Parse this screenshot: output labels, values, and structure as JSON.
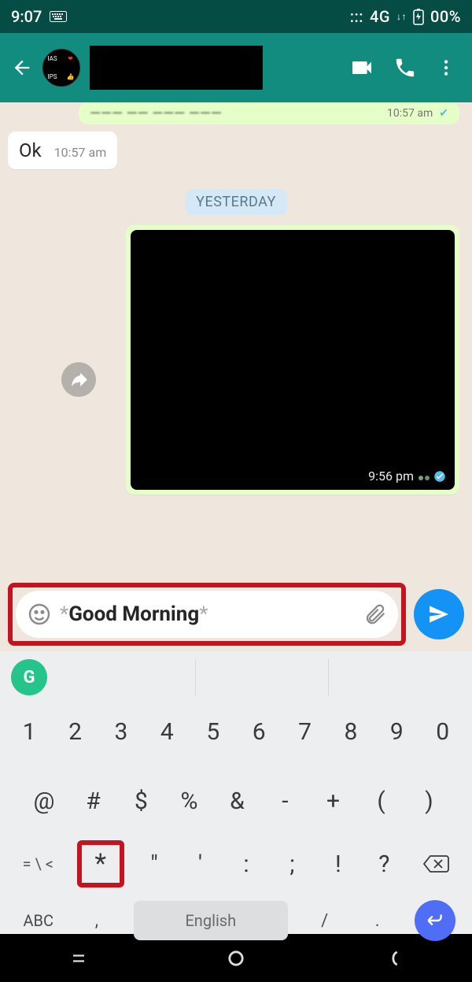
{
  "status": {
    "time": "9:07",
    "net": "4G",
    "battery": "00%"
  },
  "chat": {
    "prev_time": "10:57 am",
    "ok_text": "Ok",
    "ok_time": "10:57 am",
    "date_label": "YESTERDAY",
    "img_time": "9:56 pm"
  },
  "compose": {
    "asterisk": "*",
    "text": "Good Morning"
  },
  "keyboard": {
    "nums": [
      "1",
      "2",
      "3",
      "4",
      "5",
      "6",
      "7",
      "8",
      "9",
      "0"
    ],
    "sym1": [
      "@",
      "#",
      "$",
      "%",
      "&",
      "-",
      "+",
      "(",
      ")"
    ],
    "shift": "= \\ <",
    "sym2": [
      "*",
      "\"",
      "'",
      ":",
      ";",
      "!",
      "?"
    ],
    "abc": "ABC",
    "space": "English",
    "slash": "/",
    "dot": "."
  }
}
